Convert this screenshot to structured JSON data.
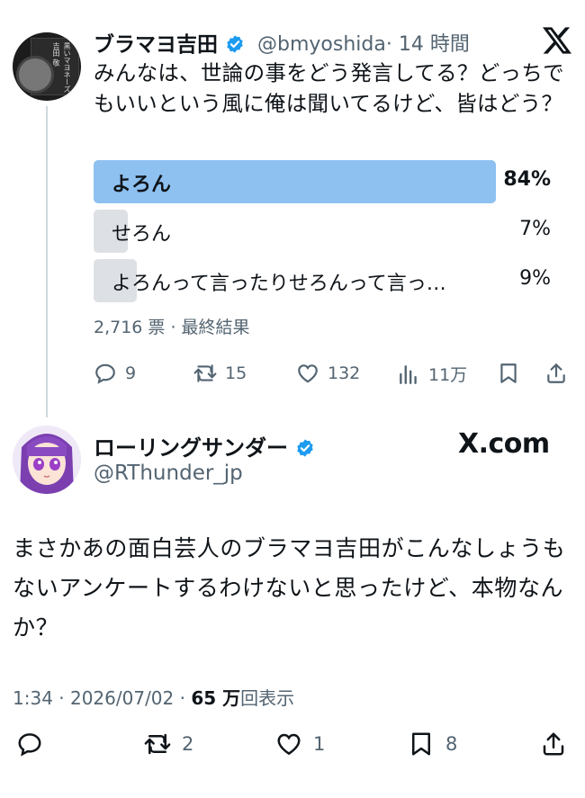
{
  "quoted": {
    "name": "ブラマヨ吉田",
    "handle": "@bmyoshida",
    "time": "· 14 時間",
    "text": "みんなは、世論の事をどう発言してる？どっちでもいいという風に俺は聞いてるけど、皆はどう？",
    "poll": [
      {
        "label": "よろん",
        "percent": "84%",
        "fraction": 0.84,
        "winner": true
      },
      {
        "label": "せろん",
        "percent": "7%",
        "fraction": 0.07,
        "winner": false
      },
      {
        "label": "よろんって言ったりせろんって言っ…",
        "percent": "9%",
        "fraction": 0.09,
        "winner": false
      }
    ],
    "votes": "2,716 票 · 最終結果",
    "actions": {
      "replies": "9",
      "retweets": "15",
      "likes": "132",
      "views": "11万"
    }
  },
  "main": {
    "name": "ローリングサンダー",
    "handle": "@RThunder_jp",
    "watermark": "X.com",
    "text": "まさかあの面白芸人のブラマヨ吉田がこんなしょうもないアンケートするわけないと思ったけど、本物なんか？",
    "time": "1:34 · 2026/07/02 · ",
    "views_count": "65 万",
    "views_label": "回表示",
    "actions": {
      "replies": "",
      "retweets": "2",
      "likes": "1",
      "bookmarks": "8"
    }
  },
  "colors": {
    "verified": "#1d9bf0",
    "poll_winner": "#8ec1f0",
    "poll_other": "#dde1e5"
  }
}
